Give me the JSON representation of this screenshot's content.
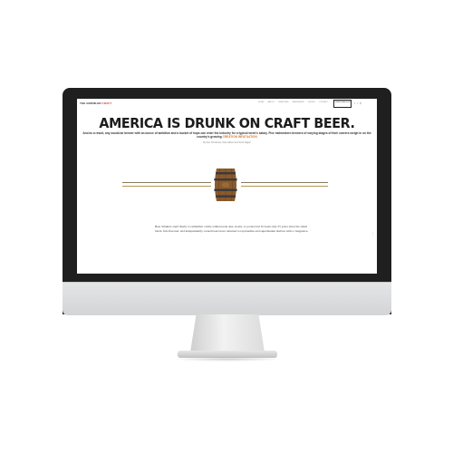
{
  "site": {
    "logo_part1": "THE GROWLER",
    "logo_part2": "CRAFT",
    "nav": [
      "HOME",
      "ABOUT",
      "FEATURES",
      "BREWERIES",
      "ISSUES",
      "CONTACT"
    ],
    "subscribe_label": "SUBSCRIBE NOW",
    "icons": [
      "facebook-icon",
      "twitter-icon",
      "search-icon"
    ]
  },
  "article": {
    "headline": "AMERICA IS DRUNK ON CRAFT BEER.",
    "dek": "And as a result, any would-be brewer with an ounce of ambition and a bucket of hops can enter the industry for a typical week's salary. Five midwestern brewers of varying stages of their careers weigh in on the country's growing",
    "dek_link": "CREATION INFATUATION",
    "byline": "By Alex Poindexter, Nate Gilbert and Scott Hagan",
    "body": "Beer drinkers aren't likely to remember a time without pale ales, stouts, or porters but it's been only 35 years since the small batch, full-flavored, and independently owned beers have returned to tap handles and supermarket shelves with a vengeance."
  },
  "colors": {
    "accent": "#d93a2b",
    "link": "#e07a2a",
    "rule": "#b49656",
    "bezel": "#1f1f1f"
  }
}
